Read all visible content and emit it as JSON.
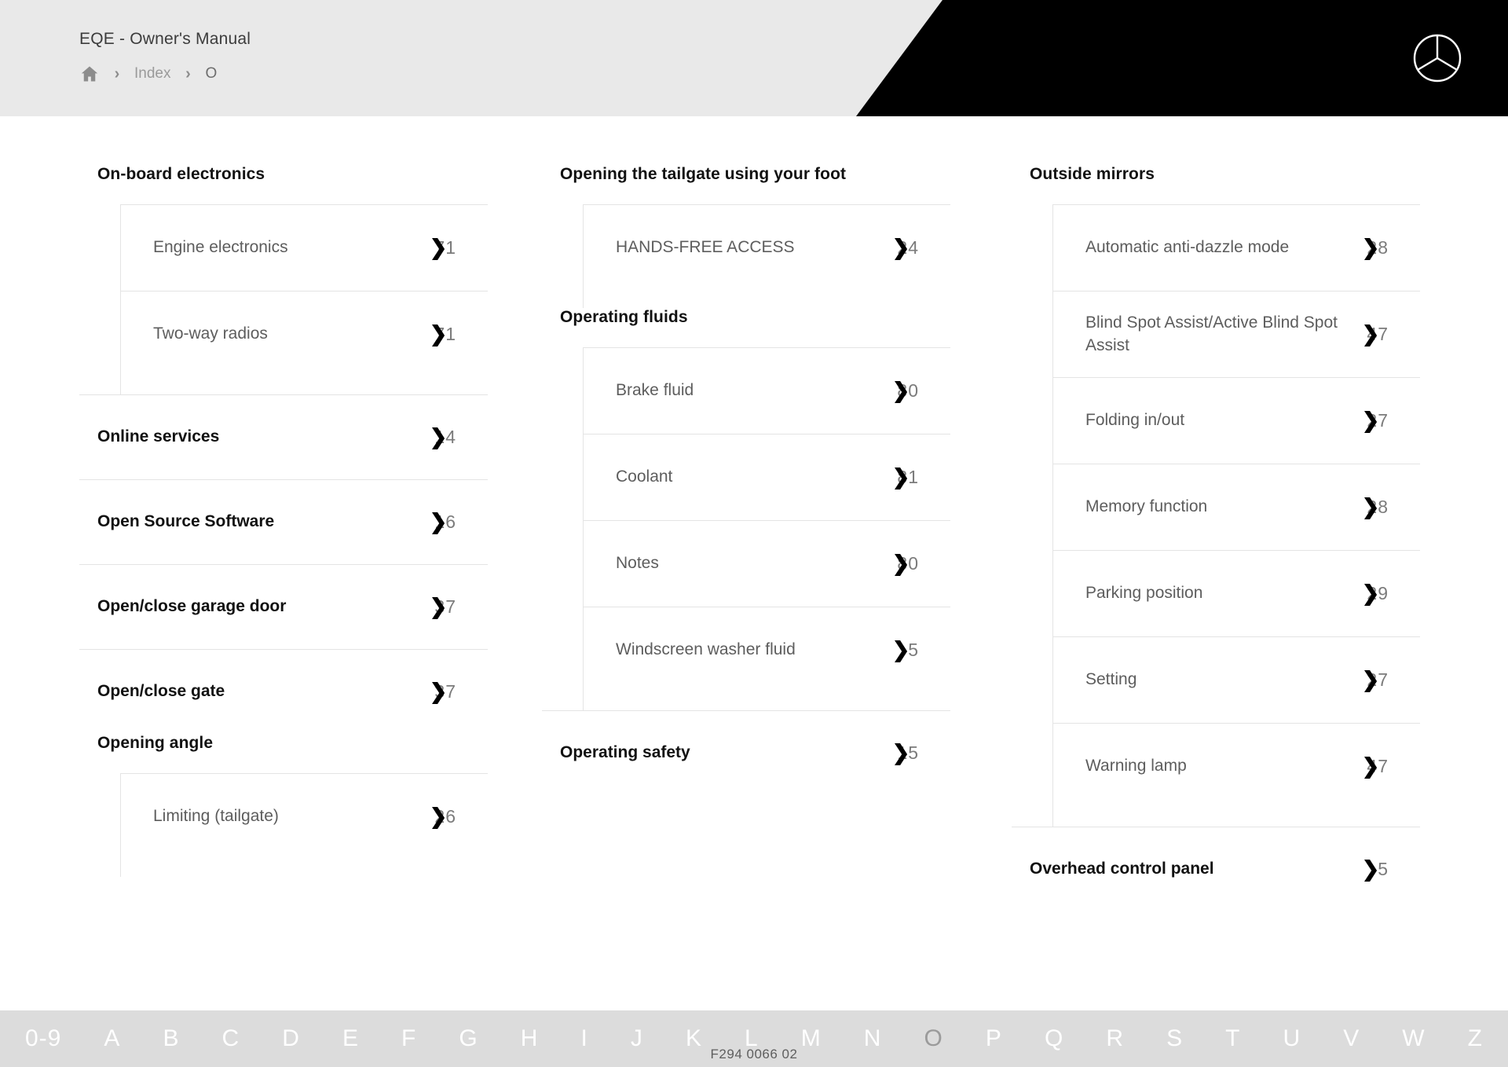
{
  "header": {
    "title": "EQE - Owner's Manual",
    "home_icon": "home-icon",
    "separator": "›",
    "breadcrumb_index": "Index",
    "breadcrumb_current": "O",
    "logo": "mercedes-benz-star-logo"
  },
  "chevron": "❯",
  "columns": [
    {
      "blocks": [
        {
          "type": "group",
          "title": "On-board electronics",
          "items": [
            {
              "label": "Engine electronics",
              "page": "7❯1",
              "page_prefix": "7",
              "page_suffix": "1"
            },
            {
              "label": "Two-way radios",
              "page": "7❯1",
              "page_prefix": "7",
              "page_suffix": "1"
            }
          ]
        },
        {
          "type": "entry",
          "label": "Online services",
          "page_prefix": "1",
          "page_suffix": "4"
        },
        {
          "type": "entry",
          "label": "Open Source Software",
          "page_prefix": "1",
          "page_suffix": "6"
        },
        {
          "type": "entry",
          "label": "Open/close garage door",
          "page_prefix": "3",
          "page_suffix": "7"
        },
        {
          "type": "entry",
          "label": "Open/close gate",
          "page_prefix": "3",
          "page_suffix": "7"
        },
        {
          "type": "group",
          "title": "Opening angle",
          "items": [
            {
              "label": "Limiting (tailgate)",
              "page_prefix": "2",
              "page_suffix": "6"
            }
          ]
        }
      ]
    },
    {
      "blocks": [
        {
          "type": "group",
          "title": "Opening the tailgate using your foot",
          "items": [
            {
              "label": "HANDS-FREE ACCESS",
              "page_prefix": "2",
              "page_suffix": "4"
            }
          ]
        },
        {
          "type": "group",
          "title": "Operating fluids",
          "items": [
            {
              "label": "Brake fluid",
              "page_prefix": "8",
              "page_suffix": "0"
            },
            {
              "label": "Coolant",
              "page_prefix": "8",
              "page_suffix": "1"
            },
            {
              "label": "Notes",
              "page_prefix": "8",
              "page_suffix": "0"
            },
            {
              "label": "Windscreen washer fluid",
              "page_prefix": "",
              "page_suffix": "5"
            }
          ]
        },
        {
          "type": "entry",
          "label": "Operating safety",
          "page_prefix": "1",
          "page_suffix": "5"
        }
      ]
    },
    {
      "blocks": [
        {
          "type": "group",
          "title": "Outside mirrors",
          "items": [
            {
              "label": "Automatic anti-dazzle mode",
              "page_prefix": "2",
              "page_suffix": "8"
            },
            {
              "label": "Blind Spot Assist/Active Blind Spot Assist",
              "page_prefix": "4",
              "page_suffix": "7"
            },
            {
              "label": "Folding in/out",
              "page_prefix": "2",
              "page_suffix": "7"
            },
            {
              "label": "Memory function",
              "page_prefix": "2",
              "page_suffix": "8"
            },
            {
              "label": "Parking position",
              "page_prefix": "2",
              "page_suffix": "9"
            },
            {
              "label": "Setting",
              "page_prefix": "2",
              "page_suffix": "7"
            },
            {
              "label": "Warning lamp",
              "page_prefix": "4",
              "page_suffix": "7"
            }
          ]
        },
        {
          "type": "entry",
          "label": "Overhead control panel",
          "page_prefix": "",
          "page_suffix": "5"
        }
      ]
    }
  ],
  "alphabet": {
    "letters": [
      "0-9",
      "A",
      "B",
      "C",
      "D",
      "E",
      "F",
      "G",
      "H",
      "I",
      "J",
      "K",
      "L",
      "M",
      "N",
      "O",
      "P",
      "Q",
      "R",
      "S",
      "T",
      "U",
      "V",
      "W",
      "Z"
    ],
    "active": "O"
  },
  "footer": {
    "document_code": "F294 0066 02"
  },
  "colors": {
    "header_bg": "#e9e9e9",
    "accent_black": "#000000",
    "alphabar_bg": "#dcdcdc",
    "text_primary": "#111111",
    "text_secondary": "#5d5d5d"
  }
}
